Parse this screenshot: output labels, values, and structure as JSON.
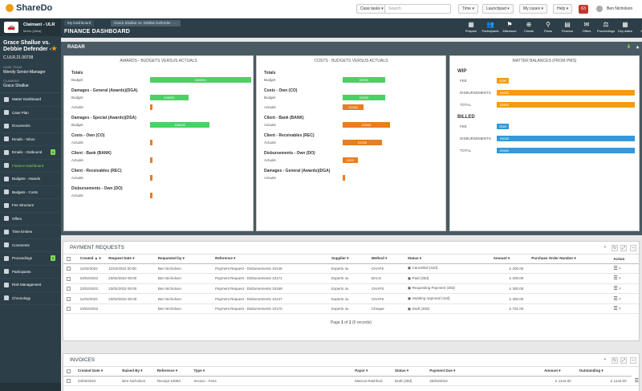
{
  "topbar": {
    "logo": "ShareDo",
    "case_tasks": "Case tasks ▾",
    "search_placeholder": "Search",
    "time": "Time ▾",
    "launchpad": "Launchpad ▾",
    "my_cases": "My cases ▾",
    "help": "Help ▾",
    "mail_count": "63",
    "user": "Ben Nicholson"
  },
  "sidebar": {
    "case_type": "Claimant - ULR",
    "case_subtype": "Motor (Ultra)",
    "case_name": "Grace Shallue vs. Debbie Defender - -",
    "case_ref": "C.ULR.21.00738",
    "team_label": "CASE TEAM",
    "team_value": "Wendy Senior-Manager",
    "claimant_label": "CLAIMANT",
    "claimant_value": "Grace Shallue",
    "items": [
      {
        "label": "Matter Dashboard"
      },
      {
        "label": "Case Plan"
      },
      {
        "label": "Documents"
      },
      {
        "label": "Emails - Inbox"
      },
      {
        "label": "Emails - Outbound",
        "badge": "6"
      },
      {
        "label": "Finance Dashboard"
      },
      {
        "label": "Budgets - Awards"
      },
      {
        "label": "Budgets - Costs"
      },
      {
        "label": "Fee Structure"
      },
      {
        "label": "Offers"
      },
      {
        "label": "Time Entries"
      },
      {
        "label": "Comments"
      },
      {
        "label": "Proceedings",
        "badge": "5"
      },
      {
        "label": "Participants"
      },
      {
        "label": "Risk Management"
      },
      {
        "label": "Chronology"
      }
    ]
  },
  "header": {
    "breadcrumb_1": "My Dashboard",
    "breadcrumb_2": "Grace Shallue vs. Debbie Defender - ...",
    "title": "FINANCE DASHBOARD",
    "actions": [
      "Prepare",
      "Participants",
      "Milestone",
      "Create",
      "Plans",
      "Finance",
      "Offers",
      "Proceedings",
      "Key dates",
      "More"
    ]
  },
  "radar": {
    "title": "RADAR",
    "awards": {
      "title": "AWARDS - BUDGETS VERSUS ACTUALS",
      "groups": [
        {
          "name": "Totals",
          "rows": [
            {
              "label": "Budget",
              "value": "£80000",
              "frac": 1.0,
              "color": "#4cd066"
            }
          ]
        },
        {
          "name": "Damages - General (Awards)(DGA)",
          "rows": [
            {
              "label": "Budget",
              "value": "£36000",
              "frac": 0.38,
              "color": "#4cd066"
            },
            {
              "label": "Actuals",
              "value": "",
              "frac": 0,
              "color": "#e67e22"
            }
          ]
        },
        {
          "name": "Damages - Special (Awards)(DSA)",
          "rows": [
            {
              "label": "Budget",
              "value": "£56000",
              "frac": 0.59,
              "color": "#4cd066"
            }
          ]
        },
        {
          "name": "Costs - Own (CO)",
          "rows": [
            {
              "label": "Actuals",
              "value": "",
              "frac": 0.02,
              "color": "#e67e22"
            }
          ]
        },
        {
          "name": "Client - Bank (BANK)",
          "rows": [
            {
              "label": "Actuals",
              "value": "",
              "frac": 0.02,
              "color": "#e67e22"
            }
          ]
        },
        {
          "name": "Client - Receivables (REC)",
          "rows": [
            {
              "label": "Actuals",
              "value": "",
              "frac": 0.02,
              "color": "#e67e22"
            }
          ]
        },
        {
          "name": "Disbursements - Own (DO)",
          "rows": [
            {
              "label": "Actuals",
              "value": "",
              "frac": 0.02,
              "color": "#e67e22"
            }
          ]
        }
      ]
    },
    "costs": {
      "title": "COSTS - BUDGETS VERSUS ACTUALS",
      "groups": [
        {
          "name": "Totals",
          "rows": [
            {
              "label": "Budget",
              "value": "£2500",
              "frac": 0.42,
              "color": "#4cd066"
            }
          ]
        },
        {
          "name": "Costs - Own (CO)",
          "rows": [
            {
              "label": "Budget",
              "value": "£2500",
              "frac": 0.42,
              "color": "#4cd066"
            },
            {
              "label": "Actuals",
              "value": "£1264",
              "frac": 0.21,
              "color": "#e67e22"
            }
          ]
        },
        {
          "name": "Client - Bank (BANK)",
          "rows": [
            {
              "label": "Actuals",
              "value": "£2843",
              "frac": 0.47,
              "color": "#e67e22"
            }
          ]
        },
        {
          "name": "Client - Receivables (REC)",
          "rows": [
            {
              "label": "Actuals",
              "value": "£2333",
              "frac": 0.39,
              "color": "#e67e22"
            }
          ]
        },
        {
          "name": "Disbursements - Own (DO)",
          "rows": [
            {
              "label": "Actuals",
              "value": "£920",
              "frac": 0.15,
              "color": "#e67e22"
            }
          ]
        },
        {
          "name": "Damages - General (Awards)(DGA)",
          "rows": [
            {
              "label": "Actuals",
              "value": "",
              "frac": 0.02,
              "color": "#e67e22"
            }
          ]
        }
      ]
    },
    "balances": {
      "title": "MATTER BALANCES (FROM PMS)",
      "wip_label": "WIP",
      "billed_label": "BILLED",
      "wip": [
        {
          "label": "FEE",
          "value": "£500",
          "frac": 0.09,
          "color": "#f39c12"
        },
        {
          "label": "DISBURSEMENTS",
          "value": "£5000",
          "frac": 1.0,
          "color": "#f39c12"
        },
        {
          "label": "TOTAL",
          "value": "£5600",
          "frac": 1.0,
          "color": "#f39c12"
        }
      ],
      "billed": [
        {
          "label": "FEE",
          "value": "£500",
          "frac": 0.09,
          "color": "#3498db"
        },
        {
          "label": "DISBURSEMENTS",
          "value": "£5000",
          "frac": 1.0,
          "color": "#3498db"
        },
        {
          "label": "TOTAL",
          "value": "£5600",
          "frac": 1.0,
          "color": "#3498db"
        }
      ]
    }
  },
  "payments": {
    "title": "PAYMENT REQUESTS",
    "columns": [
      "Created ▲ ▾",
      "Request Date ▾",
      "Requested by ▾",
      "Reference ▾",
      "Supplier ▾",
      "Method ▾",
      "Status ▾",
      "Amount ▾",
      "Purchase Order Number ▾",
      "Action"
    ],
    "rows": [
      [
        "11/02/2022",
        "11/02/2022 00:00",
        "Ben Nicholson",
        "Payment Request - Disbursements 10146",
        "Experts 4u",
        "CHAPS",
        "Cancelled (42d)",
        "£ 200.00",
        ""
      ],
      [
        "23/02/2022",
        "23/02/2022 00:00",
        "Ben Nicholson",
        "Payment Request - Disbursements 10171",
        "Experts 4u",
        "BACS",
        "Paid (30d)",
        "£ 200.00",
        ""
      ],
      [
        "23/02/2022",
        "23/02/2022 00:00",
        "Ben Nicholson",
        "Payment Request - Disbursements 10169",
        "Experts 4u",
        "CHAPS",
        "Requesting Payment (30d)",
        "£ 300.00",
        ""
      ],
      [
        "11/02/2022",
        "23/02/2022 00:00",
        "Ben Nicholson",
        "Payment Request - Disbursements 10147",
        "Experts 4u",
        "CHAPS",
        "Awaiting Approval (42d)",
        "£ 300.00",
        ""
      ],
      [
        "23/02/2022",
        "",
        "Ben Nicholson",
        "Payment Request - Disbursements 10170",
        "Experts 4u",
        "Cheque",
        "Draft (30d)",
        "£ 701.00",
        ""
      ]
    ],
    "pager_prefix": "Page",
    "pager_page": "1",
    "pager_of": "of",
    "pager_total": "1",
    "pager_suffix": "(5 records)"
  },
  "invoices": {
    "title": "INVOICES",
    "columns": [
      "Created Date ▾",
      "Raised By ▾",
      "Reference ▾",
      "Type ▾",
      "Payor ▾",
      "Status ▾",
      "Payment Due ▾",
      "Amount ▾",
      "Outstanding ▾"
    ],
    "rows": [
      [
        "23/02/2022",
        "Ben Nicholson",
        "Receipt 10093",
        "Invoice - Fees",
        "Marcus Rashford",
        "Draft (30d)",
        "25/03/2022",
        "£ 1144.00",
        "£ 1144.00"
      ]
    ]
  }
}
